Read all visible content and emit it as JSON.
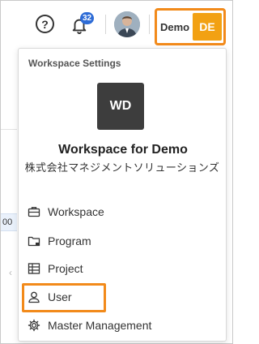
{
  "header": {
    "help_icon_glyph": "?",
    "notification_count": "32",
    "account": {
      "name": "Demo",
      "initials": "DE"
    }
  },
  "background": {
    "fragment_text": "00"
  },
  "dropdown": {
    "section_title": "Workspace Settings",
    "workspace": {
      "logo_text": "WD",
      "name": "Workspace for Demo",
      "company": "株式会社マネジメントソリューションズ"
    },
    "menu": [
      {
        "label": "Workspace",
        "icon": "briefcase-icon"
      },
      {
        "label": "Program",
        "icon": "folder-icon"
      },
      {
        "label": "Project",
        "icon": "project-icon"
      },
      {
        "label": "User",
        "icon": "user-icon"
      },
      {
        "label": "Master Management",
        "icon": "gear-icon"
      }
    ]
  },
  "colors": {
    "highlight": "#f28a1a",
    "initials_bg": "#f2a113",
    "badge": "#2d6bd6",
    "logo_bg": "#3d3d3d"
  }
}
